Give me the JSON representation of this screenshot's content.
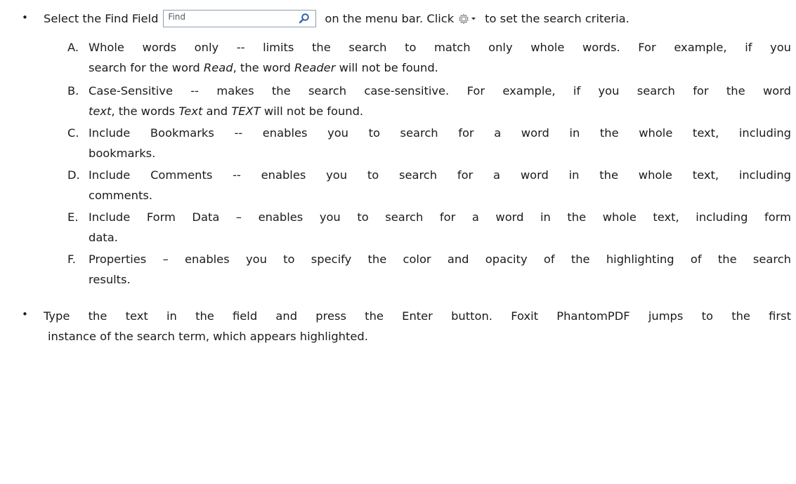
{
  "bullet1": {
    "bullet": "•",
    "before": "Select the Find Field",
    "find_placeholder": "Find",
    "after_field": "on the menu bar. Click",
    "after_gear": "to set the search criteria."
  },
  "items": [
    {
      "letter": "A.",
      "line1": "Whole words only -- limits the search to match only whole words. For example, if you",
      "line2_a": "search for the word ",
      "line2_em1": "Read",
      "line2_b": ", the word ",
      "line2_em2": "Reader",
      "line2_c": " will not be found."
    },
    {
      "letter": "B.",
      "line1": "Case-Sensitive -- makes the search case-sensitive. For example, if you search for the word",
      "line2_em0": "text",
      "line2_a": ", the words ",
      "line2_em1": "Text",
      "line2_b": " and ",
      "line2_em2": "TEXT",
      "line2_c": " will not be found."
    },
    {
      "letter": "C.",
      "line1": "Include Bookmarks -- enables you to search for a word in the whole text, including",
      "line2": "bookmarks."
    },
    {
      "letter": "D.",
      "line1": "Include Comments -- enables you to search for a word in the whole text, including",
      "line2": "comments."
    },
    {
      "letter": "E.",
      "line1": "Include Form Data – enables you to search for a word in the whole text, including form",
      "line2": "data."
    },
    {
      "letter": "F.",
      "line1": "Properties – enables you to specify the color and opacity of the highlighting of the search",
      "line2": "results."
    }
  ],
  "bullet2": {
    "bullet": "•",
    "line1": "Type the text in the field and press the Enter button. Foxit PhantomPDF jumps to the first",
    "line2": "instance of the search term, which appears highlighted."
  },
  "icons": {
    "find_box": "magnifier-icon",
    "settings": "gear-icon",
    "dropdown": "caret-down-icon"
  },
  "colors": {
    "text": "#1b1b1b",
    "find_border": "#8a9db3",
    "magnifier": "#2f63b0",
    "gear": "#7a7a7a"
  }
}
